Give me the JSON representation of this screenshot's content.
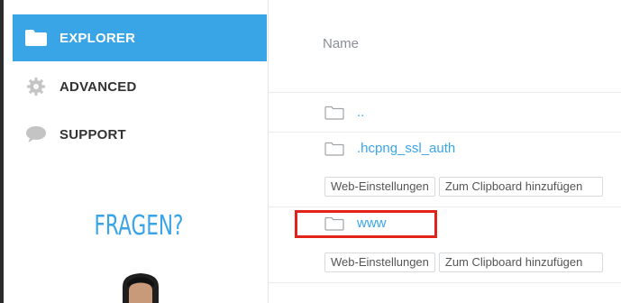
{
  "sidebar": {
    "items": [
      {
        "label": "EXPLORER",
        "icon": "folder-icon",
        "active": true
      },
      {
        "label": "ADVANCED",
        "icon": "gear-icon",
        "active": false
      },
      {
        "label": "SUPPORT",
        "icon": "chat-bubble-icon",
        "active": false
      }
    ],
    "promo_text": "FRAGEN?"
  },
  "table": {
    "header_name": "Name",
    "rows": [
      {
        "name": "..",
        "icon": "folder-icon"
      },
      {
        "name": ".hcpng_ssl_auth",
        "icon": "folder-icon",
        "actions": [
          "Web-Einstellungen",
          "Zum Clipboard hinzufügen"
        ]
      },
      {
        "name": "www",
        "icon": "folder-icon",
        "actions": [
          "Web-Einstellungen",
          "Zum Clipboard hinzufügen"
        ]
      }
    ]
  },
  "colors": {
    "accent": "#3aa5e6",
    "highlight": "#e2231a"
  }
}
